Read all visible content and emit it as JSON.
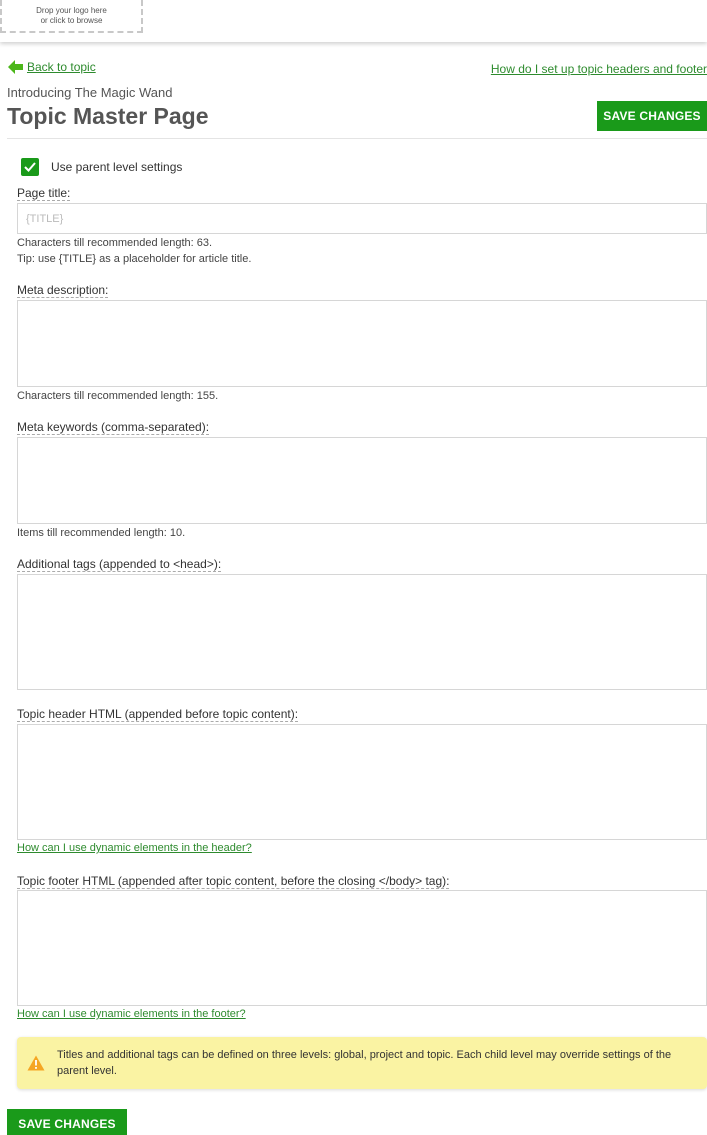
{
  "header": {
    "logo_line1": "Drop your logo here",
    "logo_line2": "or click to browse"
  },
  "nav": {
    "back_label": "Back to topic",
    "help_top_label": "How do I set up topic headers and footer"
  },
  "page": {
    "subtitle": "Introducing The Magic Wand",
    "title": "Topic Master Page",
    "save_label": "SAVE CHANGES"
  },
  "settings": {
    "use_parent_label": "Use parent level settings",
    "use_parent_checked": true
  },
  "form": {
    "page_title": {
      "label": "Page title:",
      "value": "",
      "placeholder": "{TITLE}",
      "hint1": "Characters till recommended length: 63.",
      "hint2": "Tip: use {TITLE} as a placeholder for article title."
    },
    "meta_description": {
      "label": "Meta description:",
      "value": "",
      "hint": "Characters till recommended length: 155."
    },
    "meta_keywords": {
      "label": "Meta keywords (comma-separated):",
      "value": "",
      "hint": "Items till recommended length: 10."
    },
    "additional_tags": {
      "label": "Additional tags (appended to <head>):",
      "value": ""
    },
    "topic_header": {
      "label": "Topic header HTML (appended before topic content):",
      "value": "",
      "help_link": "How can I use dynamic elements in the header?"
    },
    "topic_footer": {
      "label": "Topic footer HTML (appended after topic content, before the closing </body> tag):",
      "value": "",
      "help_link": "How can I use dynamic elements in the footer?"
    }
  },
  "notice": {
    "text": "Titles and additional tags can be defined on three levels: global, project and topic. Each child level may override settings of the parent level."
  },
  "colors": {
    "accent_green": "#1a9a1a",
    "link_green": "#2e8b2e",
    "notice_bg": "#faf3a3",
    "warning_orange": "#f5a623"
  },
  "icons": {
    "back": "arrow-left-icon",
    "checkbox": "checkmark-icon",
    "notice": "warning-triangle-icon"
  }
}
